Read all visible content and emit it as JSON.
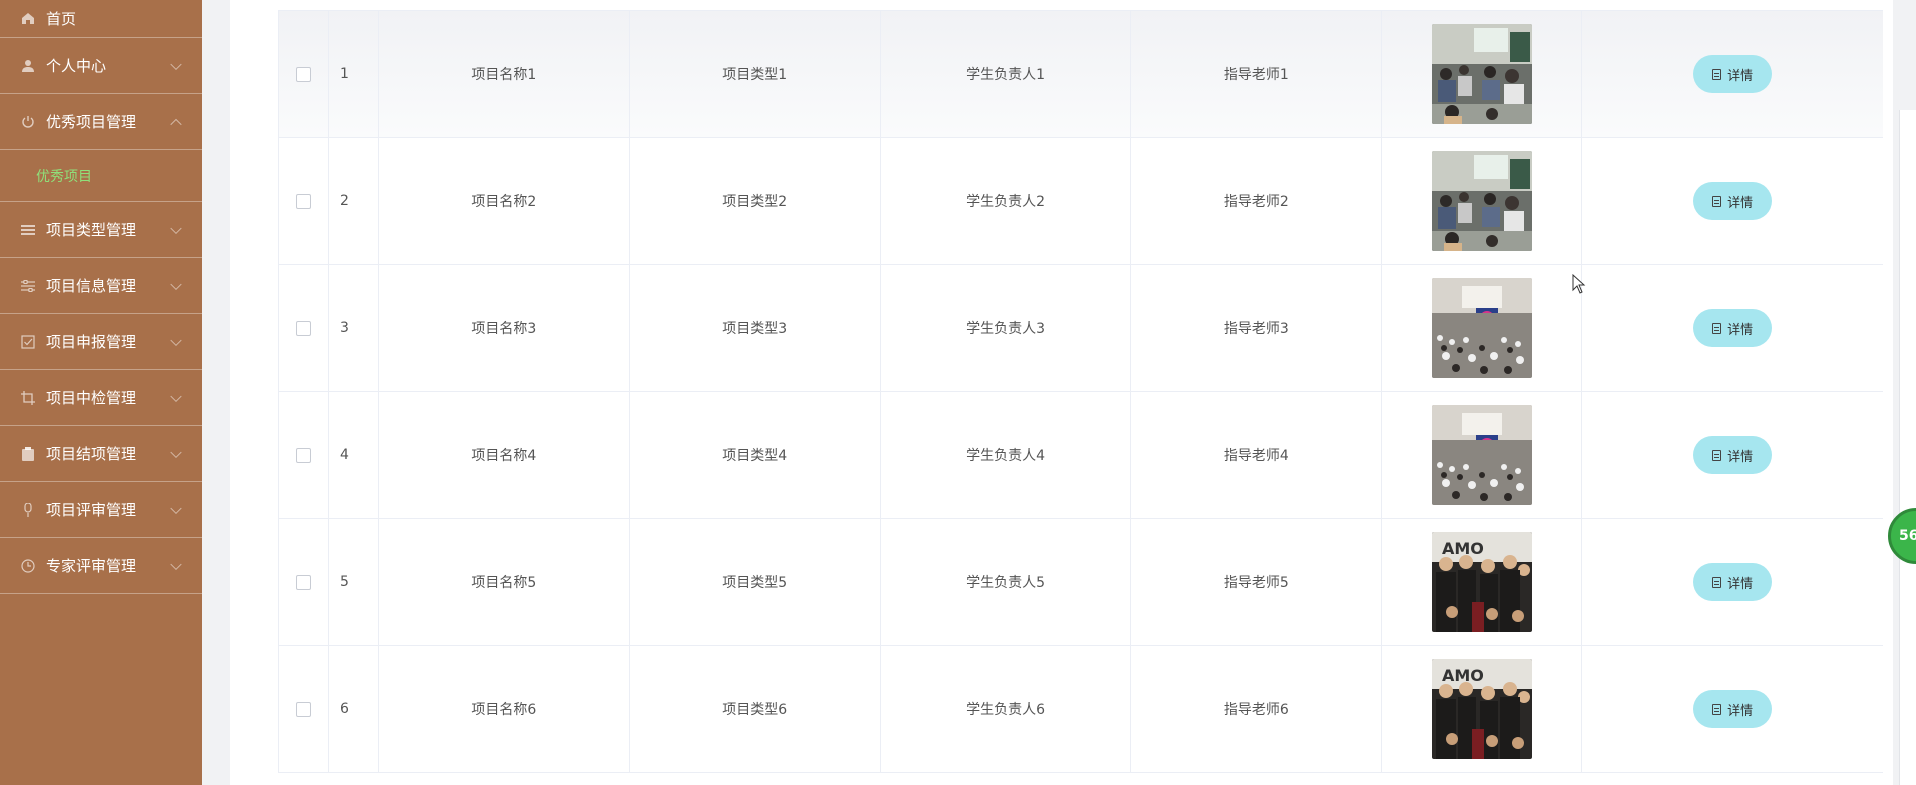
{
  "sidebar": {
    "items": [
      {
        "label": "首页",
        "icon": "home-icon",
        "chevron": "none"
      },
      {
        "label": "个人中心",
        "icon": "user-icon",
        "chevron": "down"
      },
      {
        "label": "优秀项目管理",
        "icon": "power-icon",
        "chevron": "up",
        "children": [
          {
            "label": "优秀项目"
          }
        ]
      },
      {
        "label": "项目类型管理",
        "icon": "list-icon",
        "chevron": "down"
      },
      {
        "label": "项目信息管理",
        "icon": "sliders-icon",
        "chevron": "down"
      },
      {
        "label": "项目申报管理",
        "icon": "check-box-icon",
        "chevron": "down"
      },
      {
        "label": "项目中检管理",
        "icon": "crop-icon",
        "chevron": "down"
      },
      {
        "label": "项目结项管理",
        "icon": "clipboard-icon",
        "chevron": "down"
      },
      {
        "label": "项目评审管理",
        "icon": "mic-icon",
        "chevron": "down"
      },
      {
        "label": "专家评审管理",
        "icon": "clock-icon",
        "chevron": "down"
      }
    ],
    "submenu_active_color": "#8fe07a",
    "background": "#a8704a"
  },
  "table": {
    "action_label": "详情",
    "action_icon": "document-icon",
    "rows": [
      {
        "index": "1",
        "name": "项目名称1",
        "type": "项目类型1",
        "student": "学生负责人1",
        "teacher": "指导老师1",
        "image": "classroom"
      },
      {
        "index": "2",
        "name": "项目名称2",
        "type": "项目类型2",
        "student": "学生负责人2",
        "teacher": "指导老师2",
        "image": "classroom"
      },
      {
        "index": "3",
        "name": "项目名称3",
        "type": "项目类型3",
        "student": "学生负责人3",
        "teacher": "指导老师3",
        "image": "hall"
      },
      {
        "index": "4",
        "name": "项目名称4",
        "type": "项目类型4",
        "student": "学生负责人4",
        "teacher": "指导老师4",
        "image": "hall"
      },
      {
        "index": "5",
        "name": "项目名称5",
        "type": "项目类型5",
        "student": "学生负责人5",
        "teacher": "指导老师5",
        "image": "group"
      },
      {
        "index": "6",
        "name": "项目名称6",
        "type": "项目类型6",
        "student": "学生负责人6",
        "teacher": "指导老师6",
        "image": "group"
      }
    ],
    "button_color": "#a6e6ef"
  },
  "float_badge": {
    "text": "56"
  }
}
